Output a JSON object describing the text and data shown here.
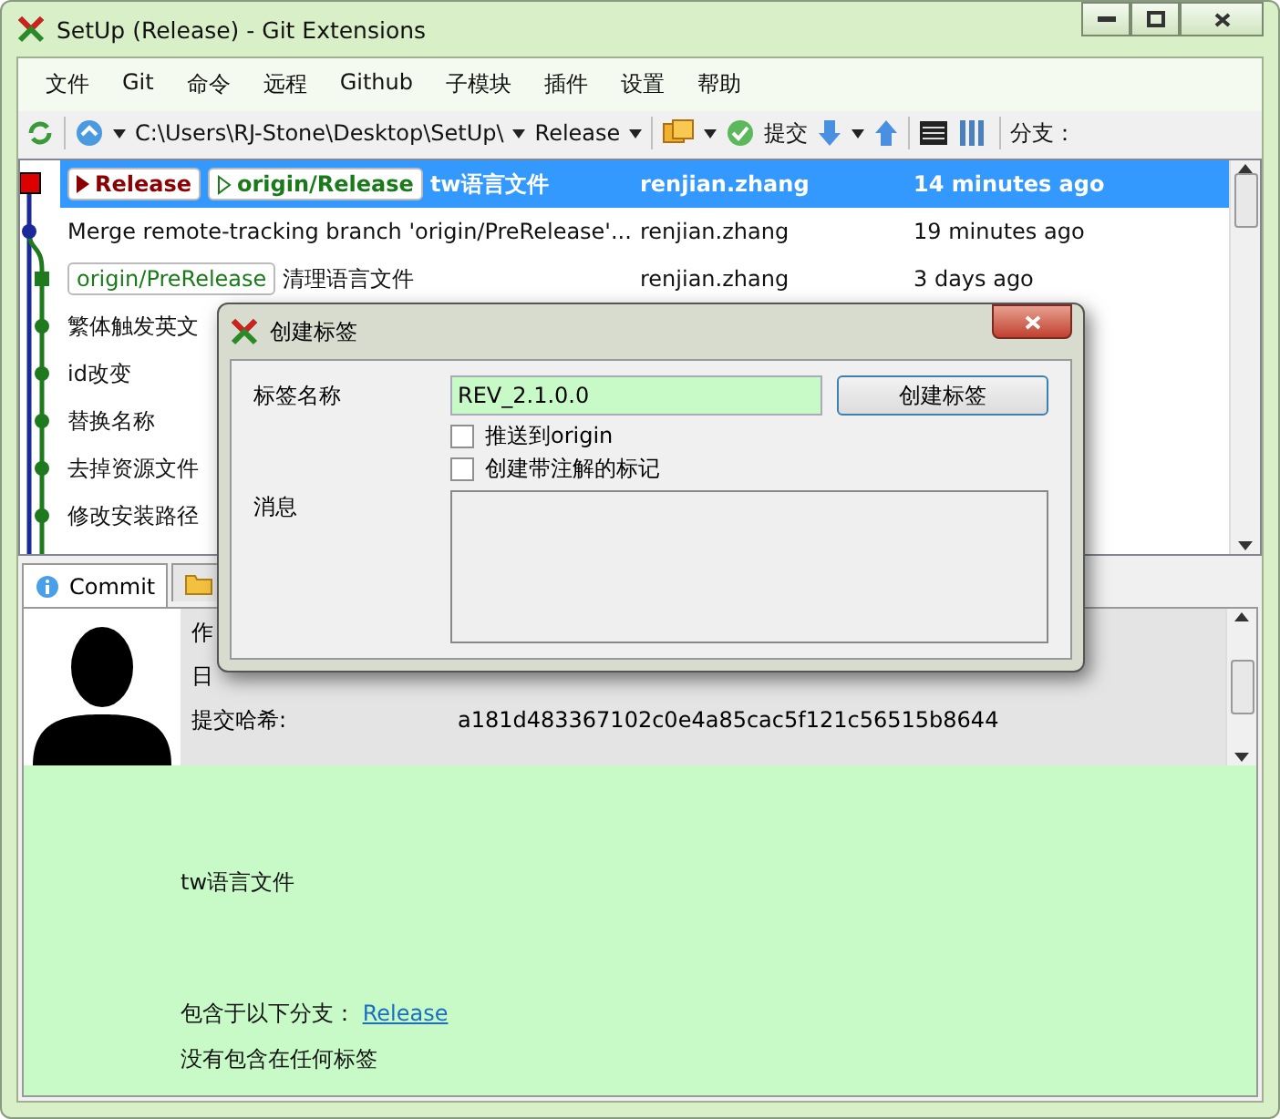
{
  "window": {
    "title": "SetUp (Release) - Git Extensions"
  },
  "menu": [
    "文件",
    "Git",
    "命令",
    "远程",
    "Github",
    "子模块",
    "插件",
    "设置",
    "帮助"
  ],
  "toolbar": {
    "path": "C:\\Users\\RJ-Stone\\Desktop\\SetUp\\",
    "branch": "Release",
    "commit_label": "提交",
    "branch_label": "分支："
  },
  "commits": [
    {
      "message": "tw语言文件",
      "author": "renjian.zhang",
      "date": "14 minutes ago",
      "selected": true,
      "refs": [
        {
          "name": "Release",
          "kind": "local"
        },
        {
          "name": "origin/Release",
          "kind": "remote"
        }
      ]
    },
    {
      "message": "Merge remote-tracking branch 'origin/PreRelease'...",
      "author": "renjian.zhang",
      "date": "19 minutes ago",
      "selected": false
    },
    {
      "message": "清理语言文件",
      "author": "renjian.zhang",
      "date": "3 days ago",
      "selected": false,
      "refs": [
        {
          "name": "origin/PreRelease",
          "kind": "plain"
        }
      ]
    },
    {
      "message": "繁体触发英文",
      "selected": false
    },
    {
      "message": "id改变",
      "selected": false
    },
    {
      "message": "替换名称",
      "selected": false
    },
    {
      "message": "去掉资源文件",
      "selected": false
    },
    {
      "message": "修改安装路径",
      "selected": false
    }
  ],
  "tabs": [
    {
      "label": "Commit",
      "selected": true
    },
    {
      "selected": false
    }
  ],
  "commit_info": {
    "author_label": "作",
    "date_label": "日",
    "hash_label": "提交哈希:",
    "hash": "a181d483367102c0e4a85cac5f121c56515b8644",
    "message": "tw语言文件",
    "branches_label": "包含于以下分支：",
    "branch_link": "Release",
    "tags_text": "没有包含在任何标签"
  },
  "dialog": {
    "title": "创建标签",
    "name_label": "标签名称",
    "name_value": "REV_2.1.0.0",
    "create_button": "创建标签",
    "checkboxes": [
      {
        "label": "推送到origin",
        "checked": false
      },
      {
        "label": "创建带注解的标记",
        "checked": false
      }
    ],
    "message_label": "消息"
  }
}
